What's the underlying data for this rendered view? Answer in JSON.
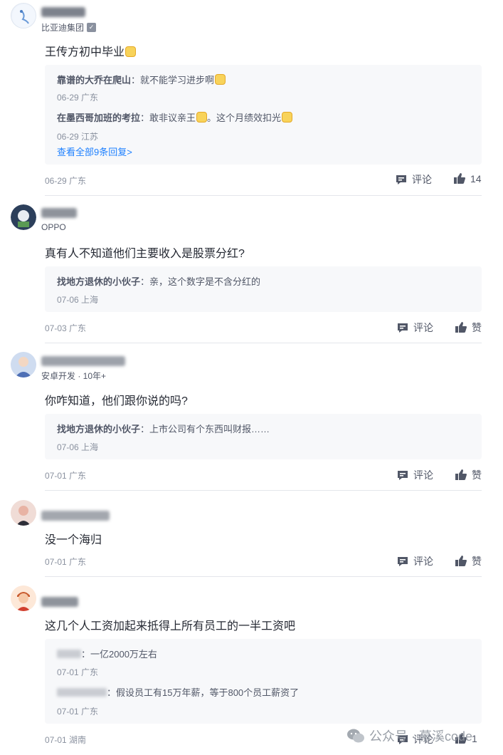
{
  "comments": [
    {
      "user_meta": "比亚迪集团",
      "content": "王传方初中毕业",
      "replies": [
        {
          "author": "靠谱的大乔在爬山",
          "text": "就不能学习进步啊",
          "time": "06-29 广东"
        },
        {
          "author": "在墨西哥加班的考拉",
          "text_a": "敢非议亲王",
          "text_b": "。这个月绩效扣光",
          "time": "06-29 江苏"
        }
      ],
      "view_all": "查看全部9条回复>",
      "time": "06-29 广东",
      "comment_label": "评论",
      "like_label": "14"
    },
    {
      "user_meta": "OPPO",
      "content": "真有人不知道他们主要收入是股票分红?",
      "replies": [
        {
          "author": "找地方退休的小伙子",
          "text": "亲，这个数字是不含分红的",
          "time": "07-06 上海"
        }
      ],
      "time": "07-03 广东",
      "comment_label": "评论",
      "like_label": "赞"
    },
    {
      "user_meta": "安卓开发 · 10年+",
      "content": "你咋知道，他们跟你说的吗?",
      "replies": [
        {
          "author": "找地方退休的小伙子",
          "text": "上市公司有个东西叫财报……",
          "time": "07-06 上海"
        }
      ],
      "time": "07-01 广东",
      "comment_label": "评论",
      "like_label": "赞"
    },
    {
      "content": "没一个海归",
      "time": "07-01 广东",
      "comment_label": "评论",
      "like_label": "赞"
    },
    {
      "content": "这几个人工资加起来抵得上所有员工的一半工资吧",
      "replies": [
        {
          "text": "一亿2000万左右",
          "time": "07-01 广东"
        },
        {
          "text": "假设员工有15万年薪，等于800个员工薪资了",
          "time": "07-01 广东"
        }
      ],
      "time": "07-01 湖南",
      "comment_label": "评论",
      "like_label": "1"
    }
  ],
  "watermark": {
    "text": "公众号 · 慕溪code"
  },
  "colors": {
    "link": "#1e80ff",
    "muted": "#8a919f",
    "reply_bg": "#f7f8fa"
  }
}
